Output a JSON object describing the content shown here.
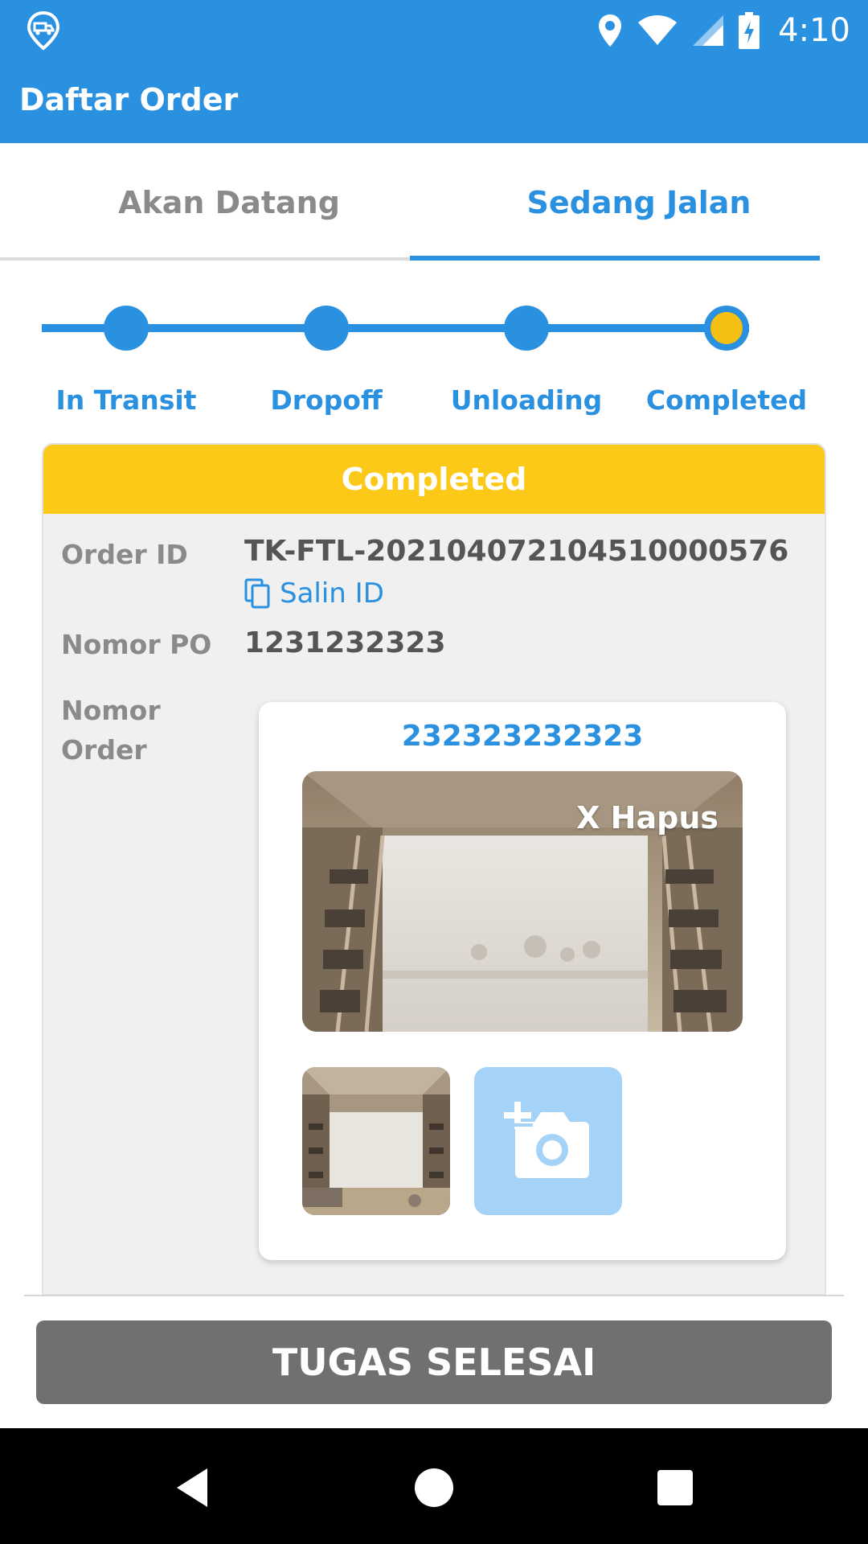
{
  "status_bar": {
    "time": "4:10"
  },
  "app_bar": {
    "title": "Daftar Order"
  },
  "tabs": [
    {
      "label": "Akan Datang",
      "active": false
    },
    {
      "label": "Sedang Jalan",
      "active": true
    }
  ],
  "stepper": {
    "steps": [
      "In Transit",
      "Dropoff",
      "Unloading",
      "Completed"
    ],
    "current_index": 3
  },
  "order_card": {
    "status_header": "Completed",
    "order_id_label": "Order ID",
    "order_id_value": "TK-FTL-20210407210451000057​6",
    "copy_label": "Salin ID",
    "po_label": "Nomor PO",
    "po_value": "1231232323",
    "order_number_label_line1": "Nomor",
    "order_number_label_line2": "Order",
    "order_number_value": "232323232323",
    "delete_label": "X Hapus"
  },
  "action_button": {
    "label": "TUGAS SELESAI"
  },
  "colors": {
    "primary": "#2a90e0",
    "status_yellow": "#fdc918",
    "button_gray": "#707070"
  }
}
